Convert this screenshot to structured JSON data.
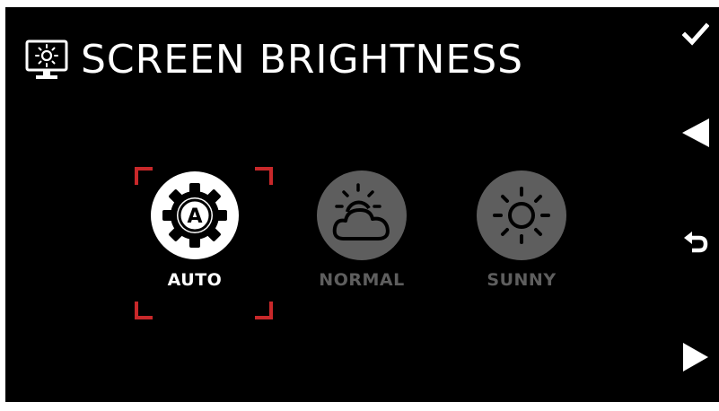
{
  "header": {
    "title": "SCREEN BRIGHTNESS",
    "icon": "monitor-brightness-icon"
  },
  "options": [
    {
      "id": "auto",
      "label": "AUTO",
      "icon": "auto-gear-icon",
      "selected": true
    },
    {
      "id": "normal",
      "label": "NORMAL",
      "icon": "partly-cloudy-icon",
      "selected": false
    },
    {
      "id": "sunny",
      "label": "SUNNY",
      "icon": "sun-icon",
      "selected": false
    }
  ],
  "controls": {
    "confirm": "check-icon",
    "left": "arrow-left-icon",
    "back": "return-icon",
    "right": "arrow-right-icon"
  },
  "colors": {
    "background": "#000000",
    "active": "#ffffff",
    "inactive": "#5e5e5e",
    "selection": "#c8282a"
  }
}
